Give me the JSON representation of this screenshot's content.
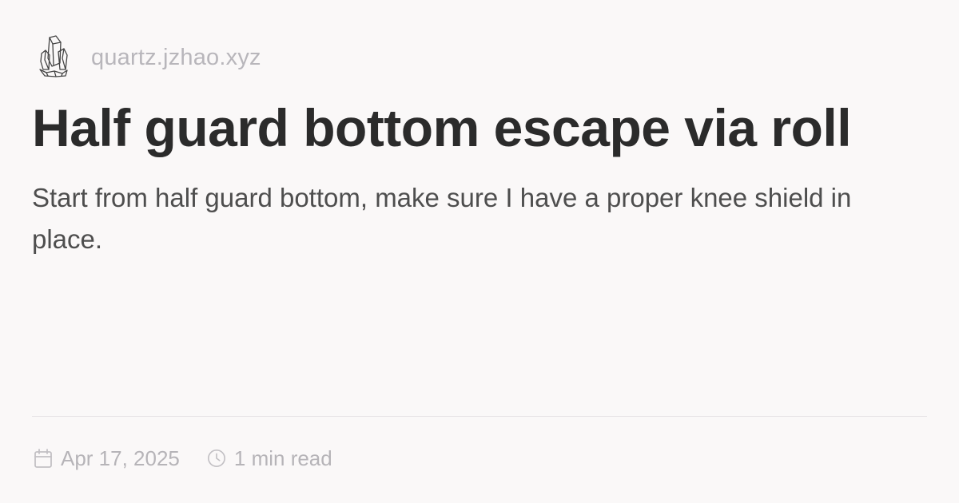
{
  "site": {
    "domain": "quartz.jzhao.xyz",
    "logo_icon": "crystal-logo-icon"
  },
  "page": {
    "title": "Half guard bottom escape via roll",
    "description": "Start from half guard bottom, make sure I have a proper knee shield in place."
  },
  "meta": {
    "date": "Apr 17, 2025",
    "date_icon": "calendar-icon",
    "reading_time": "1 min read",
    "reading_time_icon": "clock-icon"
  },
  "colors": {
    "background": "#faf8f8",
    "title": "#2b2b2b",
    "description": "#4e4e4e",
    "muted": "#b6b4b8",
    "divider": "#e7e4e6"
  }
}
